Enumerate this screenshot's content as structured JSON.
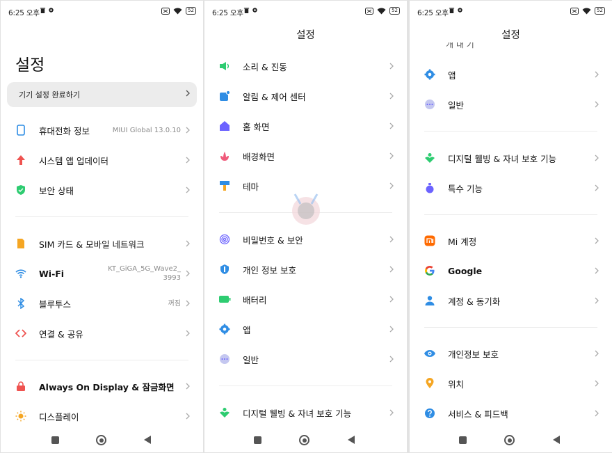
{
  "status_bar": {
    "time": "6:25 오후",
    "battery": "52"
  },
  "screen1": {
    "title": "설정",
    "banner": "기기 설정 완료하기",
    "items": [
      {
        "label": "휴대전화 정보",
        "value": "MIUI Global 13.0.10"
      },
      {
        "label": "시스템 앱 업데이터"
      },
      {
        "label": "보안 상태"
      },
      {
        "label": "SIM 카드 & 모바일 네트워크"
      },
      {
        "label": "Wi-Fi",
        "value_line1": "KT_GiGA_5G_Wave2_",
        "value_line2": "3993"
      },
      {
        "label": "블루투스",
        "value": "꺼짐"
      },
      {
        "label": "연결 & 공유"
      },
      {
        "label": "Always On Display & 잠금화면"
      },
      {
        "label": "디스플레이"
      }
    ]
  },
  "screen2": {
    "title": "설정",
    "items": [
      {
        "label": "소리 & 진동"
      },
      {
        "label": "알림 & 제어 센터"
      },
      {
        "label": "홈 화면"
      },
      {
        "label": "배경화면"
      },
      {
        "label": "테마"
      },
      {
        "label": "비밀번호 & 보안"
      },
      {
        "label": "개인 정보 보호"
      },
      {
        "label": "배터리"
      },
      {
        "label": "앱"
      },
      {
        "label": "일반"
      },
      {
        "label": "디지털 웰빙 & 자녀 보호 기능"
      }
    ]
  },
  "screen3": {
    "title": "설정",
    "cut_text": "개 내 기",
    "items": [
      {
        "label": "앱"
      },
      {
        "label": "일반"
      },
      {
        "label": "디지털 웰빙 & 자녀 보호 기능"
      },
      {
        "label": "특수 기능"
      },
      {
        "label": "Mi 계정"
      },
      {
        "label": "Google"
      },
      {
        "label": "계정 & 동기화"
      },
      {
        "label": "개인정보 보호"
      },
      {
        "label": "위치"
      },
      {
        "label": "서비스 & 피드백"
      }
    ]
  },
  "colors": {
    "accent_blue": "#2f8de4",
    "green": "#2ecc71",
    "orange": "#f5a623",
    "red": "#ef5350",
    "purple": "#6c63ff"
  }
}
